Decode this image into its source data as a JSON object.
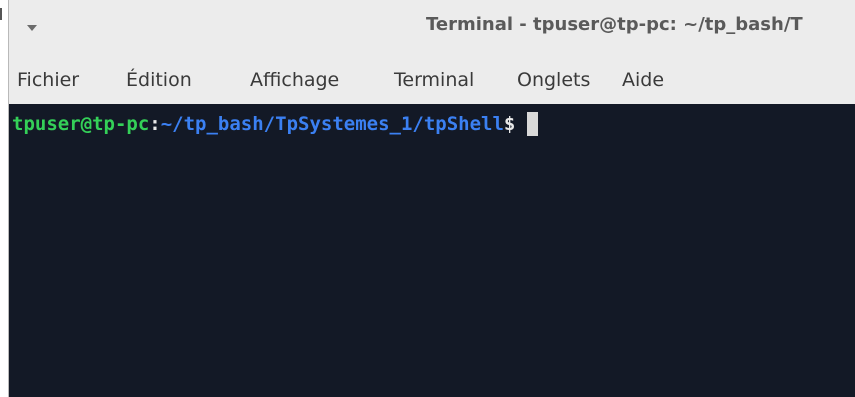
{
  "window": {
    "title": "Terminal - tpuser@tp-pc: ~/tp_bash/T"
  },
  "icons": {
    "window_menu": "chevron-down-icon"
  },
  "menubar": {
    "items": [
      {
        "label": "Fichier"
      },
      {
        "label": "Édition"
      },
      {
        "label": "Affichage"
      },
      {
        "label": "Terminal"
      },
      {
        "label": "Onglets"
      },
      {
        "label": "Aide"
      }
    ]
  },
  "terminal": {
    "prompt": {
      "user_host": "tpuser@tp-pc",
      "separator": ":",
      "path": "~/tp_bash/TpSystemes_1/tpShell",
      "symbol": "$"
    },
    "colors": {
      "background": "#131926",
      "user_host": "#34d058",
      "path": "#3b80f2",
      "text": "#e8e8e8"
    }
  }
}
